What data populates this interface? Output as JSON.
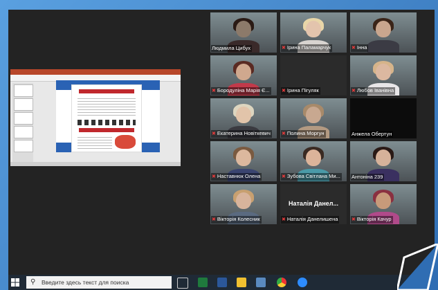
{
  "taskbar": {
    "search_placeholder": "Введите здесь текст для поиска"
  },
  "participants": [
    {
      "name": "Людмила Цибух",
      "speaking": true,
      "muted": false,
      "tone": "#8c7a6a",
      "hair": "#2a1a14",
      "shirt": "#3a2a2a"
    },
    {
      "name": "Ірина Паламарчук",
      "muted": true,
      "tone": "#e3c4ad",
      "hair": "#e8d6a8",
      "shirt": "#d8d4d0"
    },
    {
      "name": "Інна",
      "muted": true,
      "tone": "#c9a68e",
      "hair": "#3a2418",
      "shirt": "#3b3b44"
    },
    {
      "name": "Бородуліна Марія Є...",
      "muted": true,
      "tone": "#d0a88e",
      "hair": "#5a2a22",
      "shirt": "#c23a4a"
    },
    {
      "name": "Ірина Пігуляк",
      "muted": true,
      "empty": true
    },
    {
      "name": "Любов Іванівна",
      "muted": true,
      "tone": "#dcb8a0",
      "hair": "#d6b48a",
      "shirt": "#e8e6e8"
    },
    {
      "name": "Екатерина Новіткевич",
      "muted": true,
      "tone": "#e2c4aa",
      "hair": "#ddd6c0",
      "shirt": "#3a3a40"
    },
    {
      "name": "Полина Моргун",
      "muted": true,
      "tone": "#c8a890",
      "hair": "#a88a6a",
      "shirt": "#b39a82"
    },
    {
      "name": "Анжела Обертун",
      "muted": false,
      "dark": true
    },
    {
      "name": "Наставнюк Олена",
      "muted": true,
      "tone": "#dcb89e",
      "hair": "#7a5a40",
      "shirt": "#3a4470"
    },
    {
      "name": "Зубова Світлана Ми...",
      "muted": true,
      "tone": "#dcb49a",
      "hair": "#3a2a22",
      "shirt": "#4a9aa8"
    },
    {
      "name": "Антоніна 239",
      "muted": false,
      "tone": "#d6b29a",
      "hair": "#2a1a16",
      "shirt": "#3a3060"
    },
    {
      "name": "Вікторія Колесник",
      "muted": true,
      "tone": "#d8b49c",
      "hair": "#c8a070",
      "shirt": "#5a6a80"
    },
    {
      "name": "Наталія Данелишена",
      "muted": true,
      "empty": true,
      "center": "Наталія Данел..."
    },
    {
      "name": "Вікторія Качур",
      "muted": true,
      "tone": "#c89a7a",
      "hair": "#8a3040",
      "shirt": "#b04a8a"
    }
  ]
}
